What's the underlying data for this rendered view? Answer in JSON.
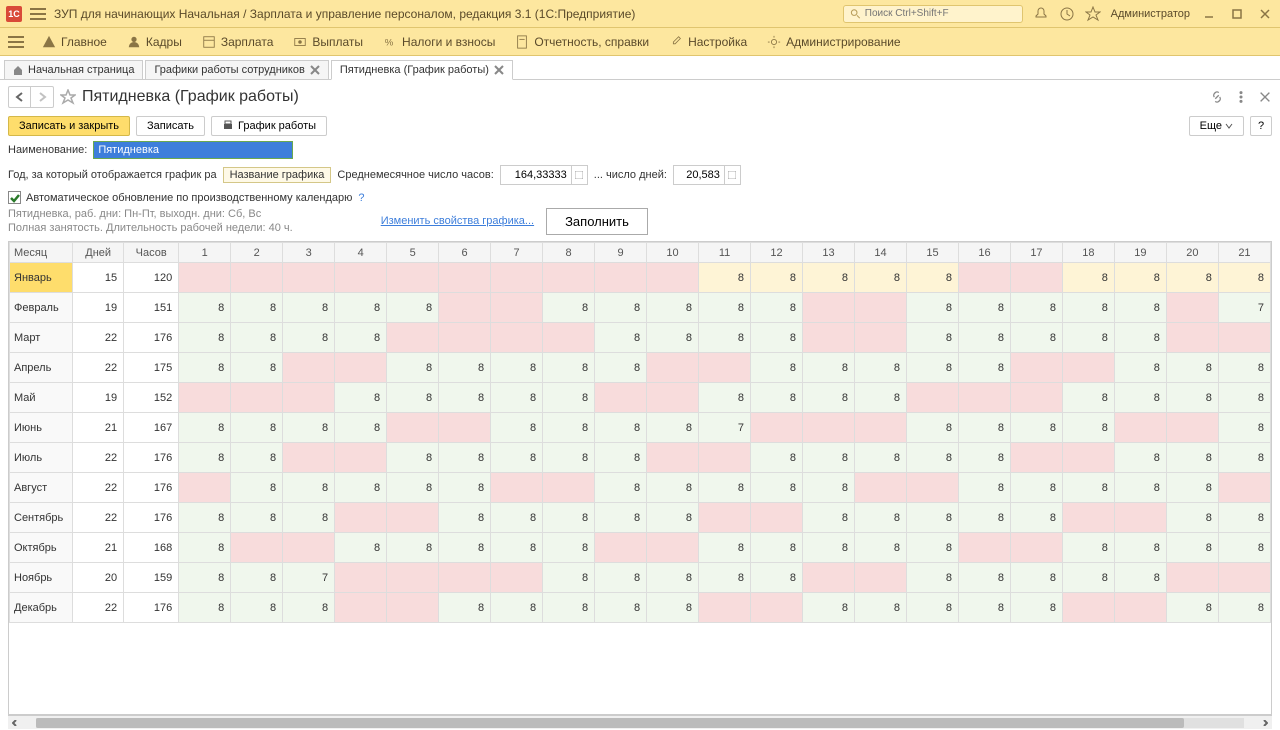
{
  "titlebar": {
    "title": "ЗУП для начинающих Начальная / Зарплата и управление персоналом, редакция 3.1  (1С:Предприятие)",
    "search_placeholder": "Поиск Ctrl+Shift+F",
    "user": "Администратор"
  },
  "menu": {
    "main": "Главное",
    "kadry": "Кадры",
    "zarplata": "Зарплата",
    "vyplaty": "Выплаты",
    "nalogi": "Налоги и взносы",
    "otchet": "Отчетность, справки",
    "nastroyka": "Настройка",
    "admin": "Администрирование"
  },
  "tabs": {
    "home": "Начальная страница",
    "tab1": "Графики работы сотрудников",
    "tab2": "Пятидневка (График работы)"
  },
  "page": {
    "title": "Пятидневка (График работы)"
  },
  "toolbar": {
    "save_close": "Записать и закрыть",
    "save": "Записать",
    "schedule": "График работы",
    "more": "Еще",
    "help": "?"
  },
  "form": {
    "name_label": "Наименование:",
    "name_value": "Пятидневка",
    "year_label": "Год, за который отображается график ра",
    "year_tooltip": "Название графика",
    "avg_hours_label": "Среднемесячное число часов:",
    "avg_hours_value": "164,33333",
    "days_label": "... число дней:",
    "days_value": "20,583",
    "auto_update": "Автоматическое обновление по производственному календарю",
    "info1": "Пятидневка, раб. дни: Пн-Пт, выходн. дни: Сб, Вс",
    "info2": "Полная занятость. Длительность рабочей недели: 40 ч.",
    "change_link": "Изменить свойства графика...",
    "fill_btn": "Заполнить"
  },
  "table": {
    "headers": [
      "Месяц",
      "Дней",
      "Часов",
      "1",
      "2",
      "3",
      "4",
      "5",
      "6",
      "7",
      "8",
      "9",
      "10",
      "11",
      "12",
      "13",
      "14",
      "15",
      "16",
      "17",
      "18",
      "19",
      "20",
      "21"
    ],
    "rows": [
      {
        "month": "Январь",
        "days": 15,
        "hours": 120,
        "cells": [
          {
            "v": "",
            "c": "p"
          },
          {
            "v": "",
            "c": "p"
          },
          {
            "v": "",
            "c": "p"
          },
          {
            "v": "",
            "c": "p"
          },
          {
            "v": "",
            "c": "p"
          },
          {
            "v": "",
            "c": "p"
          },
          {
            "v": "",
            "c": "p"
          },
          {
            "v": "",
            "c": "p"
          },
          {
            "v": "",
            "c": "p"
          },
          {
            "v": "",
            "c": "p"
          },
          {
            "v": 8,
            "c": "y"
          },
          {
            "v": 8,
            "c": "y"
          },
          {
            "v": 8,
            "c": "y"
          },
          {
            "v": 8,
            "c": "y"
          },
          {
            "v": 8,
            "c": "y"
          },
          {
            "v": "",
            "c": "p"
          },
          {
            "v": "",
            "c": "p"
          },
          {
            "v": 8,
            "c": "y"
          },
          {
            "v": 8,
            "c": "y"
          },
          {
            "v": 8,
            "c": "y"
          },
          {
            "v": 8,
            "c": "y"
          }
        ]
      },
      {
        "month": "Февраль",
        "days": 19,
        "hours": 151,
        "cells": [
          {
            "v": 8,
            "c": "g"
          },
          {
            "v": 8,
            "c": "g"
          },
          {
            "v": 8,
            "c": "g"
          },
          {
            "v": 8,
            "c": "g"
          },
          {
            "v": 8,
            "c": "g"
          },
          {
            "v": "",
            "c": "p"
          },
          {
            "v": "",
            "c": "p"
          },
          {
            "v": 8,
            "c": "g"
          },
          {
            "v": 8,
            "c": "g"
          },
          {
            "v": 8,
            "c": "g"
          },
          {
            "v": 8,
            "c": "g"
          },
          {
            "v": 8,
            "c": "g"
          },
          {
            "v": "",
            "c": "p"
          },
          {
            "v": "",
            "c": "p"
          },
          {
            "v": 8,
            "c": "g"
          },
          {
            "v": 8,
            "c": "g"
          },
          {
            "v": 8,
            "c": "g"
          },
          {
            "v": 8,
            "c": "g"
          },
          {
            "v": 8,
            "c": "g"
          },
          {
            "v": "",
            "c": "p"
          },
          {
            "v": 7,
            "c": "g"
          }
        ]
      },
      {
        "month": "Март",
        "days": 22,
        "hours": 176,
        "cells": [
          {
            "v": 8,
            "c": "g"
          },
          {
            "v": 8,
            "c": "g"
          },
          {
            "v": 8,
            "c": "g"
          },
          {
            "v": 8,
            "c": "g"
          },
          {
            "v": "",
            "c": "p"
          },
          {
            "v": "",
            "c": "p"
          },
          {
            "v": "",
            "c": "p"
          },
          {
            "v": "",
            "c": "p"
          },
          {
            "v": 8,
            "c": "g"
          },
          {
            "v": 8,
            "c": "g"
          },
          {
            "v": 8,
            "c": "g"
          },
          {
            "v": 8,
            "c": "g"
          },
          {
            "v": "",
            "c": "p"
          },
          {
            "v": "",
            "c": "p"
          },
          {
            "v": 8,
            "c": "g"
          },
          {
            "v": 8,
            "c": "g"
          },
          {
            "v": 8,
            "c": "g"
          },
          {
            "v": 8,
            "c": "g"
          },
          {
            "v": 8,
            "c": "g"
          },
          {
            "v": "",
            "c": "p"
          },
          {
            "v": "",
            "c": "p"
          }
        ]
      },
      {
        "month": "Апрель",
        "days": 22,
        "hours": 175,
        "cells": [
          {
            "v": 8,
            "c": "g"
          },
          {
            "v": 8,
            "c": "g"
          },
          {
            "v": "",
            "c": "p"
          },
          {
            "v": "",
            "c": "p"
          },
          {
            "v": 8,
            "c": "g"
          },
          {
            "v": 8,
            "c": "g"
          },
          {
            "v": 8,
            "c": "g"
          },
          {
            "v": 8,
            "c": "g"
          },
          {
            "v": 8,
            "c": "g"
          },
          {
            "v": "",
            "c": "p"
          },
          {
            "v": "",
            "c": "p"
          },
          {
            "v": 8,
            "c": "g"
          },
          {
            "v": 8,
            "c": "g"
          },
          {
            "v": 8,
            "c": "g"
          },
          {
            "v": 8,
            "c": "g"
          },
          {
            "v": 8,
            "c": "g"
          },
          {
            "v": "",
            "c": "p"
          },
          {
            "v": "",
            "c": "p"
          },
          {
            "v": 8,
            "c": "g"
          },
          {
            "v": 8,
            "c": "g"
          },
          {
            "v": 8,
            "c": "g"
          }
        ]
      },
      {
        "month": "Май",
        "days": 19,
        "hours": 152,
        "cells": [
          {
            "v": "",
            "c": "p"
          },
          {
            "v": "",
            "c": "p"
          },
          {
            "v": "",
            "c": "p"
          },
          {
            "v": 8,
            "c": "g"
          },
          {
            "v": 8,
            "c": "g"
          },
          {
            "v": 8,
            "c": "g"
          },
          {
            "v": 8,
            "c": "g"
          },
          {
            "v": 8,
            "c": "g"
          },
          {
            "v": "",
            "c": "p"
          },
          {
            "v": "",
            "c": "p"
          },
          {
            "v": 8,
            "c": "g"
          },
          {
            "v": 8,
            "c": "g"
          },
          {
            "v": 8,
            "c": "g"
          },
          {
            "v": 8,
            "c": "g"
          },
          {
            "v": "",
            "c": "p"
          },
          {
            "v": "",
            "c": "p"
          },
          {
            "v": "",
            "c": "p"
          },
          {
            "v": 8,
            "c": "g"
          },
          {
            "v": 8,
            "c": "g"
          },
          {
            "v": 8,
            "c": "g"
          },
          {
            "v": 8,
            "c": "g"
          }
        ]
      },
      {
        "month": "Июнь",
        "days": 21,
        "hours": 167,
        "cells": [
          {
            "v": 8,
            "c": "g"
          },
          {
            "v": 8,
            "c": "g"
          },
          {
            "v": 8,
            "c": "g"
          },
          {
            "v": 8,
            "c": "g"
          },
          {
            "v": "",
            "c": "p"
          },
          {
            "v": "",
            "c": "p"
          },
          {
            "v": 8,
            "c": "g"
          },
          {
            "v": 8,
            "c": "g"
          },
          {
            "v": 8,
            "c": "g"
          },
          {
            "v": 8,
            "c": "g"
          },
          {
            "v": 7,
            "c": "g"
          },
          {
            "v": "",
            "c": "p"
          },
          {
            "v": "",
            "c": "p"
          },
          {
            "v": "",
            "c": "p"
          },
          {
            "v": 8,
            "c": "g"
          },
          {
            "v": 8,
            "c": "g"
          },
          {
            "v": 8,
            "c": "g"
          },
          {
            "v": 8,
            "c": "g"
          },
          {
            "v": "",
            "c": "p"
          },
          {
            "v": "",
            "c": "p"
          },
          {
            "v": 8,
            "c": "g"
          }
        ]
      },
      {
        "month": "Июль",
        "days": 22,
        "hours": 176,
        "cells": [
          {
            "v": 8,
            "c": "g"
          },
          {
            "v": 8,
            "c": "g"
          },
          {
            "v": "",
            "c": "p"
          },
          {
            "v": "",
            "c": "p"
          },
          {
            "v": 8,
            "c": "g"
          },
          {
            "v": 8,
            "c": "g"
          },
          {
            "v": 8,
            "c": "g"
          },
          {
            "v": 8,
            "c": "g"
          },
          {
            "v": 8,
            "c": "g"
          },
          {
            "v": "",
            "c": "p"
          },
          {
            "v": "",
            "c": "p"
          },
          {
            "v": 8,
            "c": "g"
          },
          {
            "v": 8,
            "c": "g"
          },
          {
            "v": 8,
            "c": "g"
          },
          {
            "v": 8,
            "c": "g"
          },
          {
            "v": 8,
            "c": "g"
          },
          {
            "v": "",
            "c": "p"
          },
          {
            "v": "",
            "c": "p"
          },
          {
            "v": 8,
            "c": "g"
          },
          {
            "v": 8,
            "c": "g"
          },
          {
            "v": 8,
            "c": "g"
          }
        ]
      },
      {
        "month": "Август",
        "days": 22,
        "hours": 176,
        "cells": [
          {
            "v": "",
            "c": "p"
          },
          {
            "v": 8,
            "c": "g"
          },
          {
            "v": 8,
            "c": "g"
          },
          {
            "v": 8,
            "c": "g"
          },
          {
            "v": 8,
            "c": "g"
          },
          {
            "v": 8,
            "c": "g"
          },
          {
            "v": "",
            "c": "p"
          },
          {
            "v": "",
            "c": "p"
          },
          {
            "v": 8,
            "c": "g"
          },
          {
            "v": 8,
            "c": "g"
          },
          {
            "v": 8,
            "c": "g"
          },
          {
            "v": 8,
            "c": "g"
          },
          {
            "v": 8,
            "c": "g"
          },
          {
            "v": "",
            "c": "p"
          },
          {
            "v": "",
            "c": "p"
          },
          {
            "v": 8,
            "c": "g"
          },
          {
            "v": 8,
            "c": "g"
          },
          {
            "v": 8,
            "c": "g"
          },
          {
            "v": 8,
            "c": "g"
          },
          {
            "v": 8,
            "c": "g"
          },
          {
            "v": "",
            "c": "p"
          }
        ]
      },
      {
        "month": "Сентябрь",
        "days": 22,
        "hours": 176,
        "cells": [
          {
            "v": 8,
            "c": "g"
          },
          {
            "v": 8,
            "c": "g"
          },
          {
            "v": 8,
            "c": "g"
          },
          {
            "v": "",
            "c": "p"
          },
          {
            "v": "",
            "c": "p"
          },
          {
            "v": 8,
            "c": "g"
          },
          {
            "v": 8,
            "c": "g"
          },
          {
            "v": 8,
            "c": "g"
          },
          {
            "v": 8,
            "c": "g"
          },
          {
            "v": 8,
            "c": "g"
          },
          {
            "v": "",
            "c": "p"
          },
          {
            "v": "",
            "c": "p"
          },
          {
            "v": 8,
            "c": "g"
          },
          {
            "v": 8,
            "c": "g"
          },
          {
            "v": 8,
            "c": "g"
          },
          {
            "v": 8,
            "c": "g"
          },
          {
            "v": 8,
            "c": "g"
          },
          {
            "v": "",
            "c": "p"
          },
          {
            "v": "",
            "c": "p"
          },
          {
            "v": 8,
            "c": "g"
          },
          {
            "v": 8,
            "c": "g"
          }
        ]
      },
      {
        "month": "Октябрь",
        "days": 21,
        "hours": 168,
        "cells": [
          {
            "v": 8,
            "c": "g"
          },
          {
            "v": "",
            "c": "p"
          },
          {
            "v": "",
            "c": "p"
          },
          {
            "v": 8,
            "c": "g"
          },
          {
            "v": 8,
            "c": "g"
          },
          {
            "v": 8,
            "c": "g"
          },
          {
            "v": 8,
            "c": "g"
          },
          {
            "v": 8,
            "c": "g"
          },
          {
            "v": "",
            "c": "p"
          },
          {
            "v": "",
            "c": "p"
          },
          {
            "v": 8,
            "c": "g"
          },
          {
            "v": 8,
            "c": "g"
          },
          {
            "v": 8,
            "c": "g"
          },
          {
            "v": 8,
            "c": "g"
          },
          {
            "v": 8,
            "c": "g"
          },
          {
            "v": "",
            "c": "p"
          },
          {
            "v": "",
            "c": "p"
          },
          {
            "v": 8,
            "c": "g"
          },
          {
            "v": 8,
            "c": "g"
          },
          {
            "v": 8,
            "c": "g"
          },
          {
            "v": 8,
            "c": "g"
          }
        ]
      },
      {
        "month": "Ноябрь",
        "days": 20,
        "hours": 159,
        "cells": [
          {
            "v": 8,
            "c": "g"
          },
          {
            "v": 8,
            "c": "g"
          },
          {
            "v": 7,
            "c": "g"
          },
          {
            "v": "",
            "c": "p"
          },
          {
            "v": "",
            "c": "p"
          },
          {
            "v": "",
            "c": "p"
          },
          {
            "v": "",
            "c": "p"
          },
          {
            "v": 8,
            "c": "g"
          },
          {
            "v": 8,
            "c": "g"
          },
          {
            "v": 8,
            "c": "g"
          },
          {
            "v": 8,
            "c": "g"
          },
          {
            "v": 8,
            "c": "g"
          },
          {
            "v": "",
            "c": "p"
          },
          {
            "v": "",
            "c": "p"
          },
          {
            "v": 8,
            "c": "g"
          },
          {
            "v": 8,
            "c": "g"
          },
          {
            "v": 8,
            "c": "g"
          },
          {
            "v": 8,
            "c": "g"
          },
          {
            "v": 8,
            "c": "g"
          },
          {
            "v": "",
            "c": "p"
          },
          {
            "v": "",
            "c": "p"
          }
        ]
      },
      {
        "month": "Декабрь",
        "days": 22,
        "hours": 176,
        "cells": [
          {
            "v": 8,
            "c": "g"
          },
          {
            "v": 8,
            "c": "g"
          },
          {
            "v": 8,
            "c": "g"
          },
          {
            "v": "",
            "c": "p"
          },
          {
            "v": "",
            "c": "p"
          },
          {
            "v": 8,
            "c": "g"
          },
          {
            "v": 8,
            "c": "g"
          },
          {
            "v": 8,
            "c": "g"
          },
          {
            "v": 8,
            "c": "g"
          },
          {
            "v": 8,
            "c": "g"
          },
          {
            "v": "",
            "c": "p"
          },
          {
            "v": "",
            "c": "p"
          },
          {
            "v": 8,
            "c": "g"
          },
          {
            "v": 8,
            "c": "g"
          },
          {
            "v": 8,
            "c": "g"
          },
          {
            "v": 8,
            "c": "g"
          },
          {
            "v": 8,
            "c": "g"
          },
          {
            "v": "",
            "c": "p"
          },
          {
            "v": "",
            "c": "p"
          },
          {
            "v": 8,
            "c": "g"
          },
          {
            "v": 8,
            "c": "g"
          }
        ]
      }
    ]
  }
}
